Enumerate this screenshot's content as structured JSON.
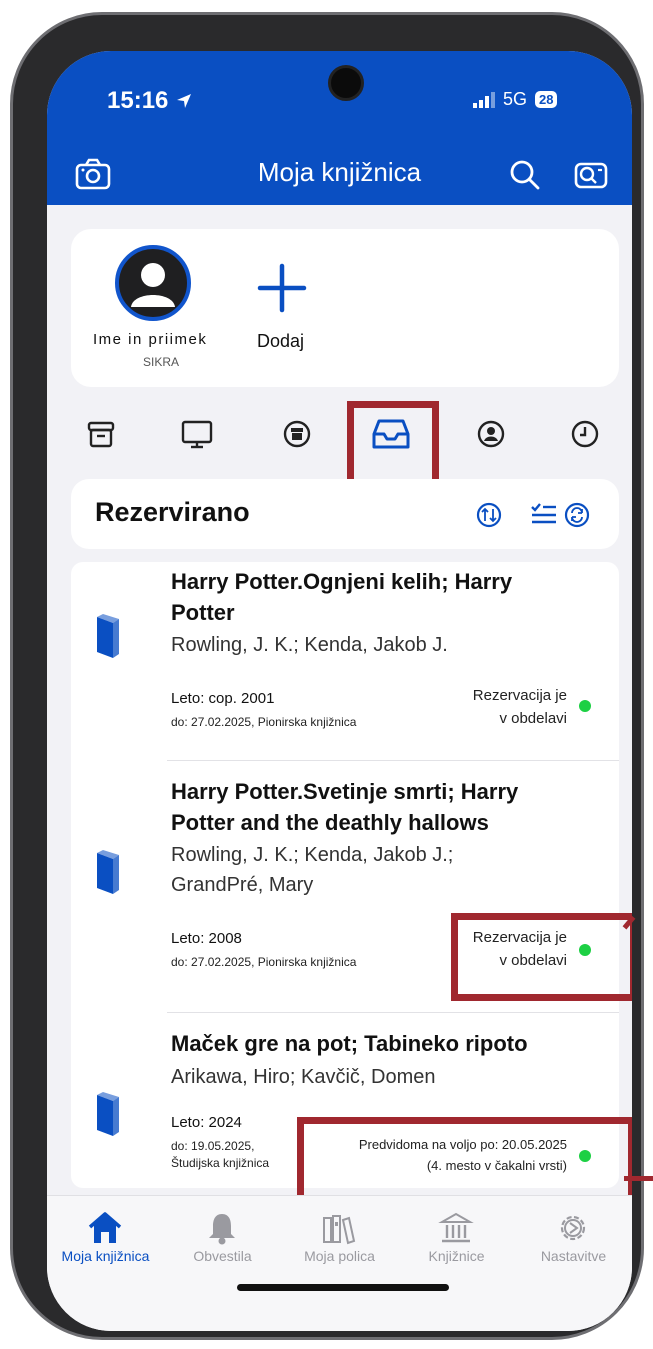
{
  "status_bar": {
    "time": "15:16",
    "network": "5G",
    "battery": "28"
  },
  "header": {
    "title": "Moja knjižnica"
  },
  "profile": {
    "name": "Ime in priimek",
    "library_code": "SIKRA",
    "add_label": "Dodaj"
  },
  "tabs": [
    "archive-icon",
    "monitor-icon",
    "box-icon",
    "inbox-icon",
    "user-circle-icon",
    "clock-icon"
  ],
  "section": {
    "title": "Rezervirano"
  },
  "items": [
    {
      "title": "Harry Potter.Ognjeni kelih; Harry Potter",
      "authors": "Rowling, J. K.; Kenda, Jakob J.",
      "year": "Leto: cop. 2001",
      "due": "do: 27.02.2025, Pionirska knjižnica",
      "status_line1": "Rezervacija je",
      "status_line2": "v obdelavi"
    },
    {
      "title": "Harry Potter.Svetinje smrti; Harry Potter and the deathly hallows",
      "authors": "Rowling, J. K.; Kenda, Jakob J.; GrandPré, Mary",
      "year": "Leto: 2008",
      "due": "do: 27.02.2025, Pionirska knjižnica",
      "status_line1": "Rezervacija je",
      "status_line2": "v obdelavi"
    },
    {
      "title": "Maček gre na pot; Tabineko ripoto",
      "authors": "Arikawa, Hiro; Kavčič, Domen",
      "year": "Leto: 2024",
      "due_line1": "do: 19.05.2025,",
      "due_line2": "Študijska knjižnica",
      "status_line1": "Predvidoma na voljo po: 20.05.2025",
      "status_line2": "(4. mesto v čakalni vrsti)"
    }
  ],
  "nav": [
    {
      "label": "Moja knjižnica",
      "icon": "home-icon",
      "active": true
    },
    {
      "label": "Obvestila",
      "icon": "bell-icon",
      "active": false
    },
    {
      "label": "Moja polica",
      "icon": "bookshelf-icon",
      "active": false
    },
    {
      "label": "Knjižnice",
      "icon": "library-building-icon",
      "active": false
    },
    {
      "label": "Nastavitve",
      "icon": "gear-icon",
      "active": false
    }
  ],
  "colors": {
    "brand": "#0a4fc2",
    "highlight": "#a0282f",
    "status_ok": "#1dd044"
  }
}
